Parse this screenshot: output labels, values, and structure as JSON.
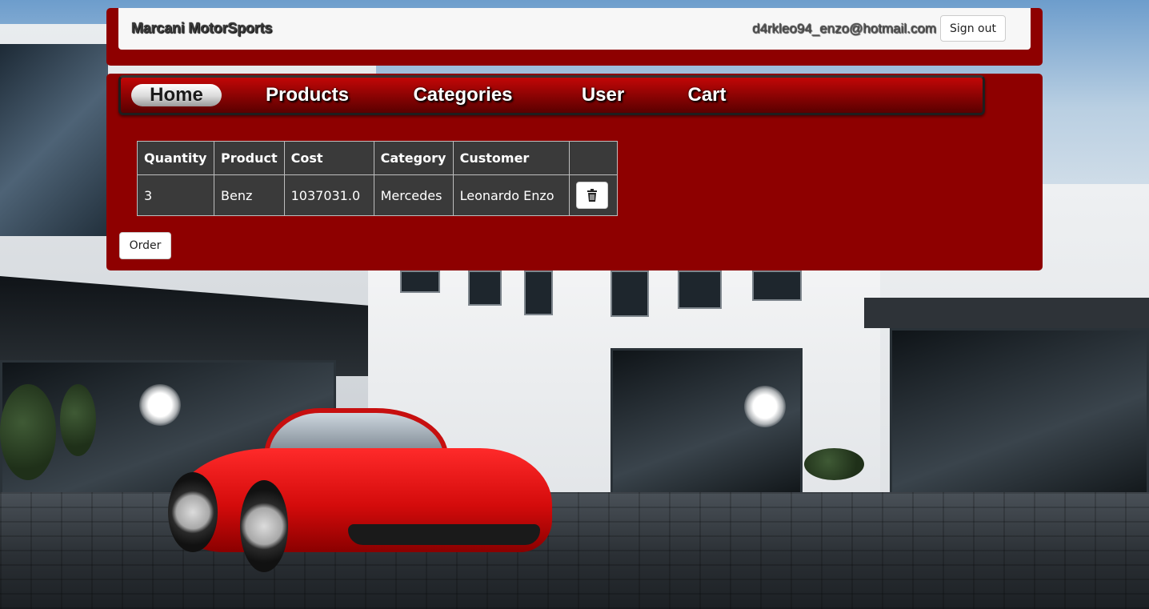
{
  "header": {
    "brand": "Marcani MotorSports",
    "user_email": "d4rkleo94_enzo@hotmail.com",
    "signout_label": "Sign out"
  },
  "nav": {
    "items": [
      {
        "label": "Home",
        "active": true
      },
      {
        "label": "Products",
        "active": false
      },
      {
        "label": "Categories",
        "active": false
      },
      {
        "label": "User",
        "active": false
      },
      {
        "label": "Cart",
        "active": false
      }
    ]
  },
  "cart": {
    "columns": [
      "Quantity",
      "Product",
      "Cost",
      "Category",
      "Customer",
      ""
    ],
    "rows": [
      {
        "quantity": "3",
        "product": "Benz",
        "cost": "1037031.0",
        "category": "Mercedes",
        "customer": "Leonardo Enzo",
        "action_icon": "trash-icon"
      }
    ],
    "order_label": "Order"
  },
  "colors": {
    "panel": "#8e0000",
    "table_cell": "#3a3a3a",
    "header_bar": "#f7f7f7"
  }
}
